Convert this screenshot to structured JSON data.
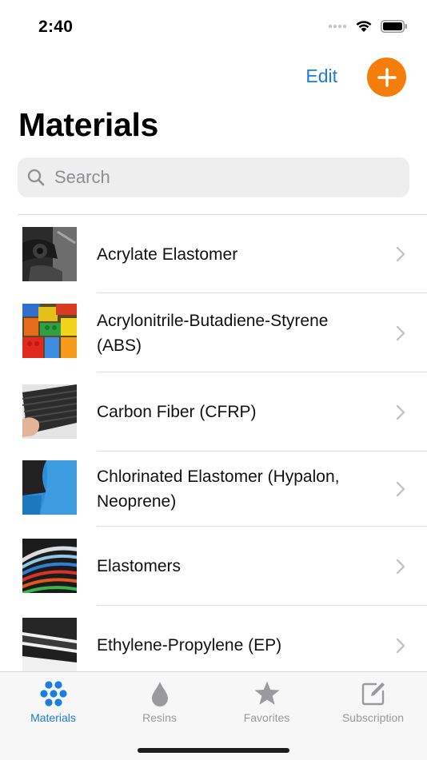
{
  "status_bar": {
    "time": "2:40"
  },
  "nav": {
    "edit_label": "Edit"
  },
  "page": {
    "title": "Materials"
  },
  "search": {
    "placeholder": "Search"
  },
  "materials": [
    {
      "name": "Acrylate Elastomer",
      "image": "acrylate-photo"
    },
    {
      "name": "Acrylonitrile-Butadiene-Styrene (ABS)",
      "image": "abs-lego-photo"
    },
    {
      "name": "Carbon Fiber (CFRP)",
      "image": "carbon-fiber-photo"
    },
    {
      "name": "Chlorinated Elastomer (Hypalon, Neoprene)",
      "image": "neoprene-photo"
    },
    {
      "name": "Elastomers",
      "image": "elastomer-tubes-photo"
    },
    {
      "name": "Ethylene-Propylene (EP)",
      "image": "ep-foam-photo"
    }
  ],
  "tabs": [
    {
      "label": "Materials",
      "icon": "hexagon-grid-icon",
      "active": true
    },
    {
      "label": "Resins",
      "icon": "drop-icon",
      "active": false
    },
    {
      "label": "Favorites",
      "icon": "star-icon",
      "active": false
    },
    {
      "label": "Subscription",
      "icon": "compose-icon",
      "active": false
    }
  ],
  "colors": {
    "accent": "#1a7de0",
    "add_button": "#f57d0b",
    "inactive": "#9a9a9e"
  }
}
